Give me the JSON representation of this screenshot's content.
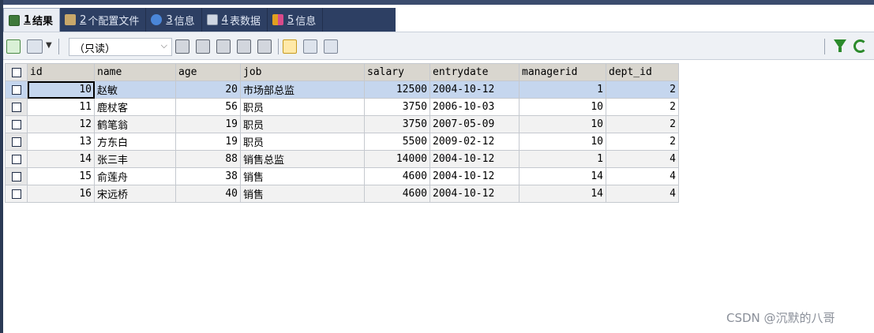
{
  "tabs": [
    {
      "num": "1",
      "label": "结果",
      "icon": "grid-result-icon",
      "active": true
    },
    {
      "num": "2",
      "label": "个配置文件",
      "icon": "profile-icon",
      "active": false
    },
    {
      "num": "3",
      "label": "信息",
      "icon": "info-icon",
      "active": false
    },
    {
      "num": "4",
      "label": "表数据",
      "icon": "table-data-icon",
      "active": false
    },
    {
      "num": "5",
      "label": "信息",
      "icon": "info-chart-icon",
      "active": false
    }
  ],
  "toolbar": {
    "mode_select": "（只读）",
    "dropdown_arrow": "▼",
    "select_arrow": "⌵"
  },
  "grid": {
    "columns": [
      "id",
      "name",
      "age",
      "job",
      "salary",
      "entrydate",
      "managerid",
      "dept_id"
    ],
    "rows": [
      [
        "10",
        "赵敏",
        "20",
        "市场部总监",
        "12500",
        "2004-10-12",
        "1",
        "2"
      ],
      [
        "11",
        "鹿杖客",
        "56",
        "职员",
        "3750",
        "2006-10-03",
        "10",
        "2"
      ],
      [
        "12",
        "鹤笔翁",
        "19",
        "职员",
        "3750",
        "2007-05-09",
        "10",
        "2"
      ],
      [
        "13",
        "方东白",
        "19",
        "职员",
        "5500",
        "2009-02-12",
        "10",
        "2"
      ],
      [
        "14",
        "张三丰",
        "88",
        "销售总监",
        "14000",
        "2004-10-12",
        "1",
        "4"
      ],
      [
        "15",
        "俞莲舟",
        "38",
        "销售",
        "4600",
        "2004-10-12",
        "14",
        "4"
      ],
      [
        "16",
        "宋远桥",
        "40",
        "销售",
        "4600",
        "2004-10-12",
        "14",
        "4"
      ]
    ]
  },
  "watermark": "CSDN @沉默的八哥"
}
